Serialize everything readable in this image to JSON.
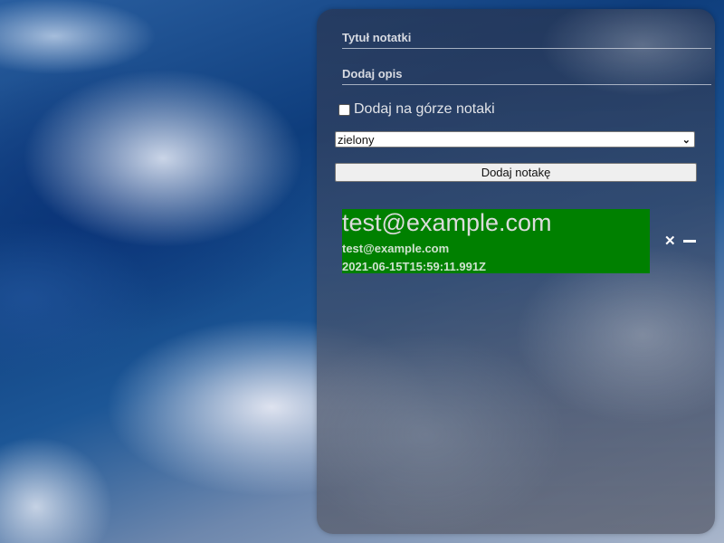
{
  "form": {
    "title_placeholder": "Tytuł notatki",
    "description_placeholder": "Dodaj opis",
    "pin_top_label": "Dodaj na górze notaki",
    "pin_top_checked": false,
    "color_select_value": "zielony",
    "add_button_label": "Dodaj notakę"
  },
  "notes": [
    {
      "title": "test@example.com",
      "description": "test@example.com",
      "date": "2021-06-15T15:59:11.991Z",
      "color": "#008000"
    }
  ],
  "icons": {
    "close": "close-icon",
    "minimize": "minus-icon",
    "select_arrow": "chevron-down-icon"
  }
}
